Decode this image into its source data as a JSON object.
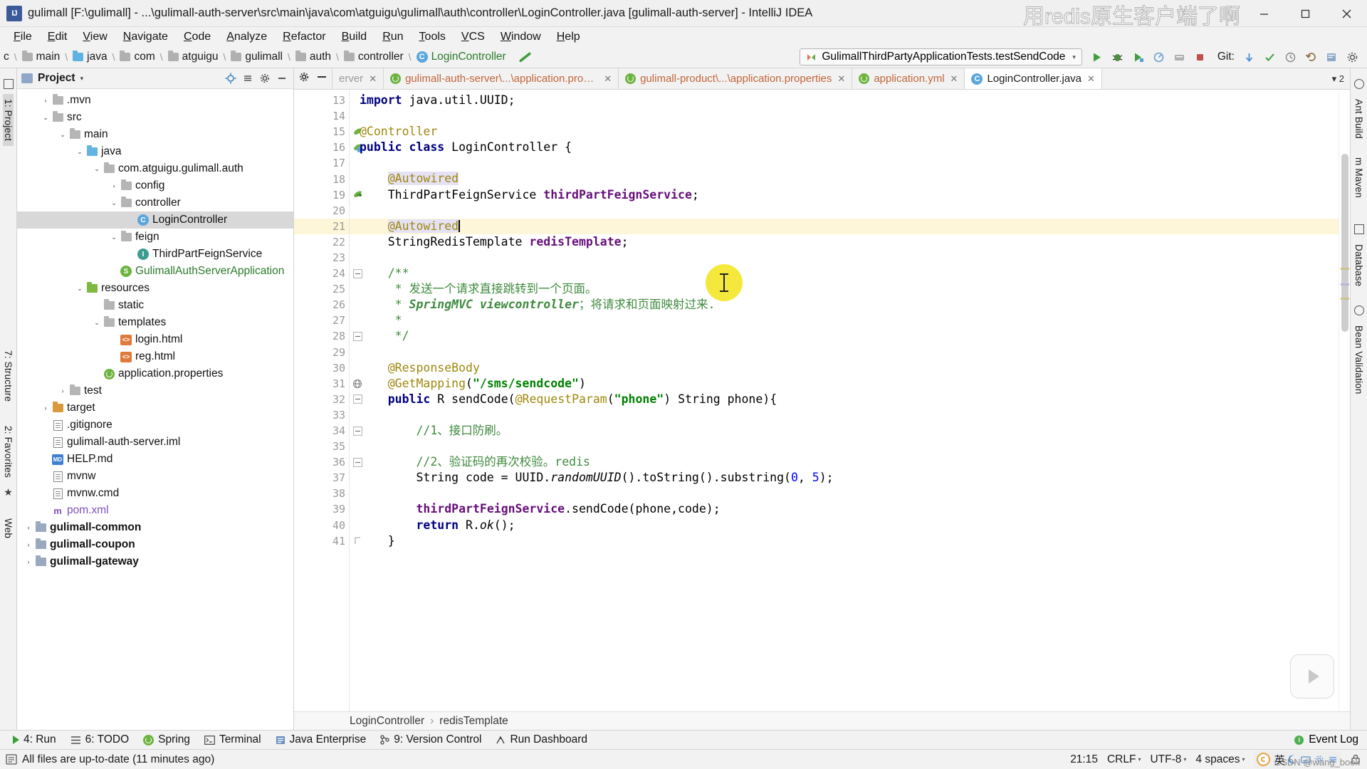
{
  "window": {
    "title": "gulimall [F:\\gulimall] - ...\\gulimall-auth-server\\src\\main\\java\\com\\atguigu\\gulimall\\auth\\controller\\LoginController.java [gulimall-auth-server] - IntelliJ IDEA",
    "app_icon": "IJ",
    "minimize": "–",
    "maximize": "☐",
    "close": "✕",
    "watermark": "用redis原生客户端了啊"
  },
  "menubar": {
    "items": [
      "File",
      "Edit",
      "View",
      "Navigate",
      "Code",
      "Analyze",
      "Refactor",
      "Build",
      "Run",
      "Tools",
      "VCS",
      "Window",
      "Help"
    ]
  },
  "navbar": {
    "breadcrumbs": [
      {
        "label": "c",
        "icon": "none"
      },
      {
        "label": "main",
        "icon": "folder-gray"
      },
      {
        "label": "java",
        "icon": "folder-blue"
      },
      {
        "label": "com",
        "icon": "folder-gray"
      },
      {
        "label": "atguigu",
        "icon": "folder-gray"
      },
      {
        "label": "gulimall",
        "icon": "folder-gray"
      },
      {
        "label": "auth",
        "icon": "folder-gray"
      },
      {
        "label": "controller",
        "icon": "folder-gray"
      },
      {
        "label": "LoginController",
        "icon": "class-icon"
      }
    ],
    "run_config": "GulimallThirdPartyApplicationTests.testSendCode",
    "run_config_dropdown": "▾",
    "git_label": "Git:",
    "tool_icons": [
      "run-icon",
      "debug-icon",
      "run-with-coverage-icon",
      "profile-icon",
      "build-icon",
      "stop-icon"
    ],
    "git_icons": [
      "update-project-icon",
      "commit-icon",
      "history-icon",
      "rollback-icon",
      "search-everywhere-icon",
      "settings-icon"
    ]
  },
  "left_rail": {
    "items": [
      "1: Project",
      "7: Structure",
      "2: Favorites",
      "Web"
    ]
  },
  "right_rail": {
    "items": [
      "Ant Build",
      "m Maven",
      "Database",
      "Bean Validation"
    ]
  },
  "project_panel": {
    "title": "Project",
    "caret": "▾",
    "actions": [
      "locate-icon",
      "collapse-all-icon",
      "settings-icon",
      "hide-icon"
    ],
    "tree": [
      {
        "indent": 1,
        "arrow": "›",
        "icon": "folder-gray",
        "label": ".mvn",
        "style": ""
      },
      {
        "indent": 1,
        "arrow": "⌄",
        "icon": "folder-gray",
        "label": "src",
        "style": ""
      },
      {
        "indent": 2,
        "arrow": "⌄",
        "icon": "folder-gray",
        "label": "main",
        "style": ""
      },
      {
        "indent": 3,
        "arrow": "⌄",
        "icon": "folder-src",
        "label": "java",
        "style": ""
      },
      {
        "indent": 4,
        "arrow": "⌄",
        "icon": "folder-gray",
        "label": "com.atguigu.gulimall.auth",
        "style": ""
      },
      {
        "indent": 5,
        "arrow": "›",
        "icon": "folder-gray",
        "label": "config",
        "style": ""
      },
      {
        "indent": 5,
        "arrow": "⌄",
        "icon": "folder-gray",
        "label": "controller",
        "style": ""
      },
      {
        "indent": 6,
        "arrow": "",
        "icon": "class-icon",
        "label": "LoginController",
        "style": "selected"
      },
      {
        "indent": 5,
        "arrow": "⌄",
        "icon": "folder-gray",
        "label": "feign",
        "style": ""
      },
      {
        "indent": 6,
        "arrow": "",
        "icon": "interface-icon",
        "label": "ThirdPartFeignService",
        "style": ""
      },
      {
        "indent": 5,
        "arrow": "",
        "icon": "spring-class-icon",
        "label": "GulimallAuthServerApplication",
        "style": "green"
      },
      {
        "indent": 3,
        "arrow": "⌄",
        "icon": "folder-res",
        "label": "resources",
        "style": ""
      },
      {
        "indent": 4,
        "arrow": "",
        "icon": "folder-gray",
        "label": "static",
        "style": ""
      },
      {
        "indent": 4,
        "arrow": "⌄",
        "icon": "folder-gray",
        "label": "templates",
        "style": ""
      },
      {
        "indent": 5,
        "arrow": "",
        "icon": "html-icon",
        "label": "login.html",
        "style": ""
      },
      {
        "indent": 5,
        "arrow": "",
        "icon": "html-icon",
        "label": "reg.html",
        "style": ""
      },
      {
        "indent": 4,
        "arrow": "",
        "icon": "spring-prop-icon",
        "label": "application.properties",
        "style": ""
      },
      {
        "indent": 2,
        "arrow": "›",
        "icon": "folder-gray",
        "label": "test",
        "style": ""
      },
      {
        "indent": 1,
        "arrow": "›",
        "icon": "folder-orange",
        "label": "target",
        "style": ""
      },
      {
        "indent": 1,
        "arrow": "",
        "icon": "file-icon",
        "label": ".gitignore",
        "style": ""
      },
      {
        "indent": 1,
        "arrow": "",
        "icon": "file-icon",
        "label": "gulimall-auth-server.iml",
        "style": ""
      },
      {
        "indent": 1,
        "arrow": "",
        "icon": "md-icon",
        "label": "HELP.md",
        "style": ""
      },
      {
        "indent": 1,
        "arrow": "",
        "icon": "file-icon",
        "label": "mvnw",
        "style": ""
      },
      {
        "indent": 1,
        "arrow": "",
        "icon": "file-icon",
        "label": "mvnw.cmd",
        "style": ""
      },
      {
        "indent": 1,
        "arrow": "",
        "icon": "maven-icon",
        "label": "pom.xml",
        "style": "maven"
      },
      {
        "indent": 0,
        "arrow": "›",
        "icon": "module-icon",
        "label": "gulimall-common",
        "style": "bold"
      },
      {
        "indent": 0,
        "arrow": "›",
        "icon": "module-icon",
        "label": "gulimall-coupon",
        "style": "bold"
      },
      {
        "indent": 0,
        "arrow": "›",
        "icon": "module-icon",
        "label": "gulimall-gateway",
        "style": "bold"
      }
    ]
  },
  "editor": {
    "tab_tools": [
      "settings-icon",
      "minimize-icon"
    ],
    "tabs": [
      {
        "label": "erver",
        "icon": "none",
        "active": false,
        "truncated": true
      },
      {
        "label": "gulimall-auth-server\\...\\application.properties",
        "icon": "spring-icon",
        "active": false
      },
      {
        "label": "gulimall-product\\...\\application.properties",
        "icon": "spring-icon",
        "active": false
      },
      {
        "label": "application.yml",
        "icon": "spring-icon",
        "active": false
      },
      {
        "label": "LoginController.java",
        "icon": "class-icon",
        "active": true
      }
    ],
    "tab_overflow": "▾ 2",
    "first_line_number": 13,
    "lines": [
      {
        "n": 13,
        "gutter_mark": "",
        "highlight": false,
        "tokens": [
          {
            "t": "import",
            "c": "kw"
          },
          {
            "t": " java.util.UUID;",
            "c": ""
          }
        ]
      },
      {
        "n": 14,
        "gutter_mark": "",
        "highlight": false,
        "tokens": []
      },
      {
        "n": 15,
        "gutter_mark": "spring-bean",
        "highlight": false,
        "tokens": [
          {
            "t": "@Controller",
            "c": "ann"
          }
        ]
      },
      {
        "n": 16,
        "gutter_mark": "spring-bean2",
        "highlight": false,
        "tokens": [
          {
            "t": "public",
            "c": "kw"
          },
          {
            "t": " ",
            "c": ""
          },
          {
            "t": "class",
            "c": "kw"
          },
          {
            "t": " LoginController {",
            "c": ""
          }
        ]
      },
      {
        "n": 17,
        "gutter_mark": "",
        "highlight": false,
        "tokens": []
      },
      {
        "n": 18,
        "gutter_mark": "",
        "highlight": false,
        "tokens": [
          {
            "t": "    ",
            "c": ""
          },
          {
            "t": "@Autowired",
            "c": "ann-hl"
          }
        ]
      },
      {
        "n": 19,
        "gutter_mark": "bean-link",
        "highlight": false,
        "tokens": [
          {
            "t": "    ThirdPartFeignService ",
            "c": ""
          },
          {
            "t": "thirdPartFeignService",
            "c": "fld"
          },
          {
            "t": ";",
            "c": ""
          }
        ]
      },
      {
        "n": 20,
        "gutter_mark": "",
        "highlight": false,
        "tokens": []
      },
      {
        "n": 21,
        "gutter_mark": "bulb",
        "highlight": true,
        "tokens": [
          {
            "t": "    ",
            "c": ""
          },
          {
            "t": "@Autowired",
            "c": "ann-hl"
          },
          {
            "t": "|",
            "c": "caret"
          }
        ]
      },
      {
        "n": 22,
        "gutter_mark": "",
        "highlight": false,
        "tokens": [
          {
            "t": "    StringRedisTemplate ",
            "c": ""
          },
          {
            "t": "redisTemplate",
            "c": "fld"
          },
          {
            "t": ";",
            "c": ""
          }
        ]
      },
      {
        "n": 23,
        "gutter_mark": "",
        "highlight": false,
        "tokens": []
      },
      {
        "n": 24,
        "gutter_mark": "fold",
        "highlight": false,
        "tokens": [
          {
            "t": "    /**",
            "c": "jdoc"
          }
        ]
      },
      {
        "n": 25,
        "gutter_mark": "",
        "highlight": false,
        "tokens": [
          {
            "t": "     * ",
            "c": "jdoc"
          },
          {
            "t": "发送一个请求直接跳转到一个页面。",
            "c": "jdoc"
          }
        ]
      },
      {
        "n": 26,
        "gutter_mark": "",
        "highlight": false,
        "tokens": [
          {
            "t": "     * ",
            "c": "jdoc"
          },
          {
            "t": "SpringMVC viewcontroller",
            "c": "jdoc-i"
          },
          {
            "t": "；将请求和页面映射过来.",
            "c": "jdoc"
          }
        ]
      },
      {
        "n": 27,
        "gutter_mark": "",
        "highlight": false,
        "tokens": [
          {
            "t": "     *",
            "c": "jdoc"
          }
        ]
      },
      {
        "n": 28,
        "gutter_mark": "fold",
        "highlight": false,
        "tokens": [
          {
            "t": "     */",
            "c": "jdoc"
          }
        ]
      },
      {
        "n": 29,
        "gutter_mark": "",
        "highlight": false,
        "tokens": []
      },
      {
        "n": 30,
        "gutter_mark": "",
        "highlight": false,
        "tokens": [
          {
            "t": "    @ResponseBody",
            "c": "ann"
          }
        ]
      },
      {
        "n": 31,
        "gutter_mark": "web-link",
        "highlight": false,
        "tokens": [
          {
            "t": "    @GetMapping",
            "c": "ann"
          },
          {
            "t": "(",
            "c": ""
          },
          {
            "t": "\"/sms/sendcode\"",
            "c": "str"
          },
          {
            "t": ")",
            "c": ""
          }
        ]
      },
      {
        "n": 32,
        "gutter_mark": "fold",
        "highlight": false,
        "tokens": [
          {
            "t": "    ",
            "c": ""
          },
          {
            "t": "public",
            "c": "kw"
          },
          {
            "t": " R ",
            "c": ""
          },
          {
            "t": "sendCode",
            "c": ""
          },
          {
            "t": "(",
            "c": ""
          },
          {
            "t": "@RequestParam",
            "c": "ann"
          },
          {
            "t": "(",
            "c": ""
          },
          {
            "t": "\"phone\"",
            "c": "str"
          },
          {
            "t": ") String phone){",
            "c": ""
          }
        ]
      },
      {
        "n": 33,
        "gutter_mark": "",
        "highlight": false,
        "tokens": []
      },
      {
        "n": 34,
        "gutter_mark": "fold",
        "highlight": false,
        "tokens": [
          {
            "t": "        //1、接口防刷。",
            "c": "cmt-green"
          }
        ]
      },
      {
        "n": 35,
        "gutter_mark": "",
        "highlight": false,
        "tokens": []
      },
      {
        "n": 36,
        "gutter_mark": "fold",
        "highlight": false,
        "tokens": [
          {
            "t": "        //2、验证码的再次校验。redis",
            "c": "cmt-green"
          }
        ]
      },
      {
        "n": 37,
        "gutter_mark": "",
        "highlight": false,
        "tokens": [
          {
            "t": "        String code = UUID.",
            "c": ""
          },
          {
            "t": "randomUUID",
            "c": "mth"
          },
          {
            "t": "().toString().substring(",
            "c": ""
          },
          {
            "t": "0",
            "c": "num"
          },
          {
            "t": ", ",
            "c": ""
          },
          {
            "t": "5",
            "c": "num"
          },
          {
            "t": ");",
            "c": ""
          }
        ]
      },
      {
        "n": 38,
        "gutter_mark": "",
        "highlight": false,
        "tokens": []
      },
      {
        "n": 39,
        "gutter_mark": "",
        "highlight": false,
        "tokens": [
          {
            "t": "        ",
            "c": ""
          },
          {
            "t": "thirdPartFeignService",
            "c": "fld"
          },
          {
            "t": ".sendCode(phone,code);",
            "c": ""
          }
        ]
      },
      {
        "n": 40,
        "gutter_mark": "",
        "highlight": false,
        "tokens": [
          {
            "t": "        ",
            "c": ""
          },
          {
            "t": "return",
            "c": "kw"
          },
          {
            "t": " R.",
            "c": ""
          },
          {
            "t": "ok",
            "c": "mth"
          },
          {
            "t": "();",
            "c": ""
          }
        ]
      },
      {
        "n": 41,
        "gutter_mark": "fold-end",
        "highlight": false,
        "tokens": [
          {
            "t": "    }",
            "c": ""
          }
        ]
      }
    ],
    "bottom_breadcrumb": [
      "LoginController",
      "redisTemplate"
    ],
    "bottom_breadcrumb_sep": "›"
  },
  "tool_window_bar": {
    "items": [
      {
        "label": "4: Run",
        "icon": "run-icon"
      },
      {
        "label": "6: TODO",
        "icon": "todo-icon"
      },
      {
        "label": "Spring",
        "icon": "spring-icon"
      },
      {
        "label": "Terminal",
        "icon": "terminal-icon"
      },
      {
        "label": "Java Enterprise",
        "icon": "javaee-icon"
      },
      {
        "label": "9: Version Control",
        "icon": "vcs-icon"
      },
      {
        "label": "Run Dashboard",
        "icon": "dashboard-icon"
      }
    ],
    "event_log": "Event Log"
  },
  "status_bar": {
    "message": "All files are up-to-date (11 minutes ago)",
    "position": "21:15",
    "line_separator": "CRLF",
    "encoding": "UTF-8",
    "indent": "4 spaces",
    "ime_label": "英",
    "dropdown": "⌄",
    "csdn_watermark": "CSDN @wang_book"
  }
}
